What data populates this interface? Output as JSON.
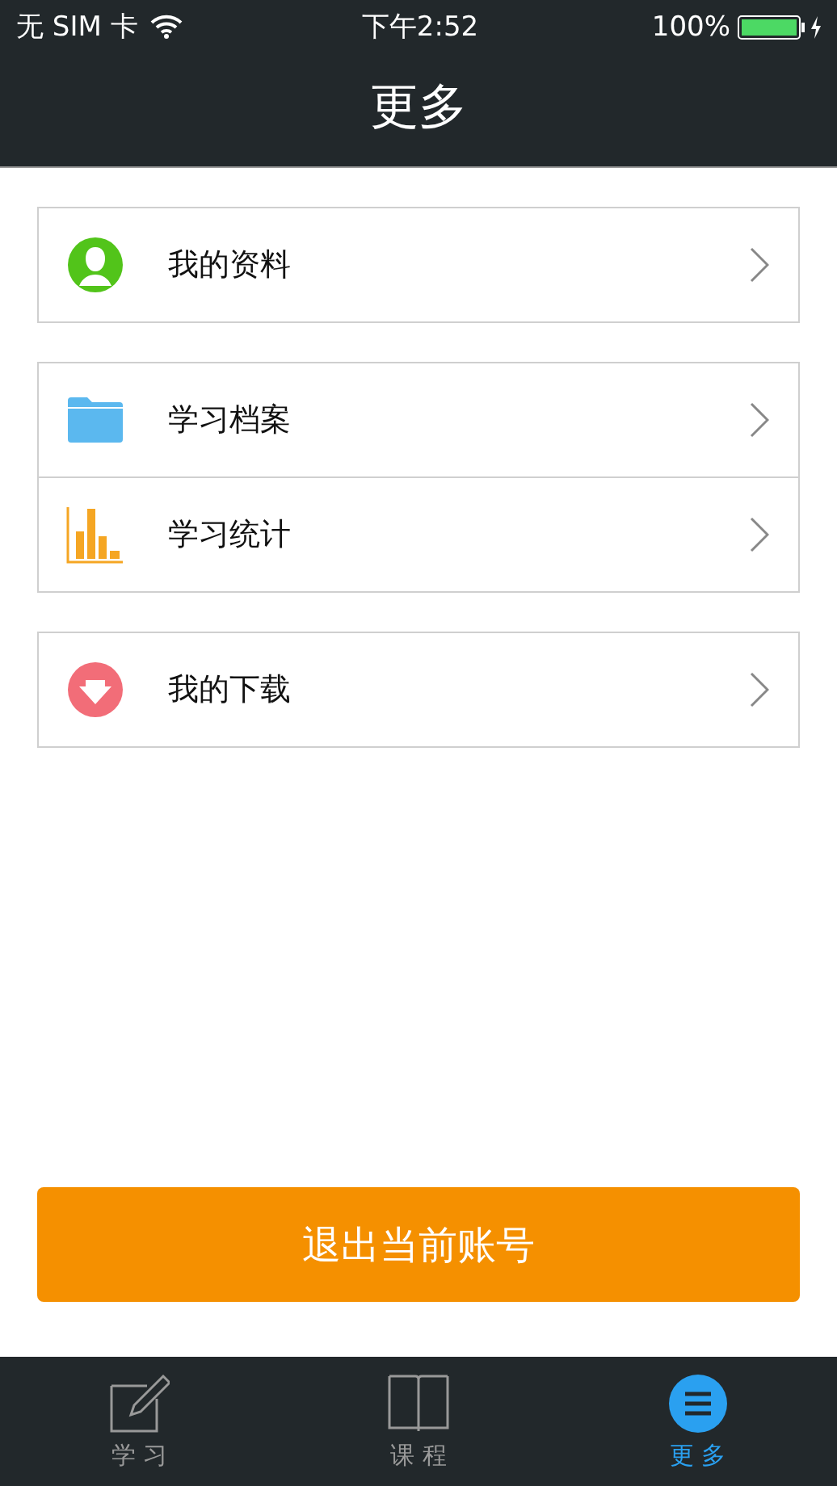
{
  "status_bar": {
    "carrier": "无 SIM 卡",
    "time": "下午2:52",
    "battery": "100%"
  },
  "nav_bar": {
    "title": "更多"
  },
  "groups": [
    {
      "items": [
        {
          "kind": "profile",
          "label": "我的资料"
        }
      ]
    },
    {
      "items": [
        {
          "kind": "folder",
          "label": "学习档案"
        },
        {
          "kind": "chart",
          "label": "学习统计"
        }
      ]
    },
    {
      "items": [
        {
          "kind": "download",
          "label": "我的下载"
        }
      ]
    }
  ],
  "logout_button": "退出当前账号",
  "tab_bar": [
    {
      "kind": "pen",
      "label": "学 习",
      "selected": false
    },
    {
      "kind": "book",
      "label": "课 程",
      "selected": false
    },
    {
      "kind": "menu",
      "label": "更 多",
      "selected": true
    }
  ]
}
